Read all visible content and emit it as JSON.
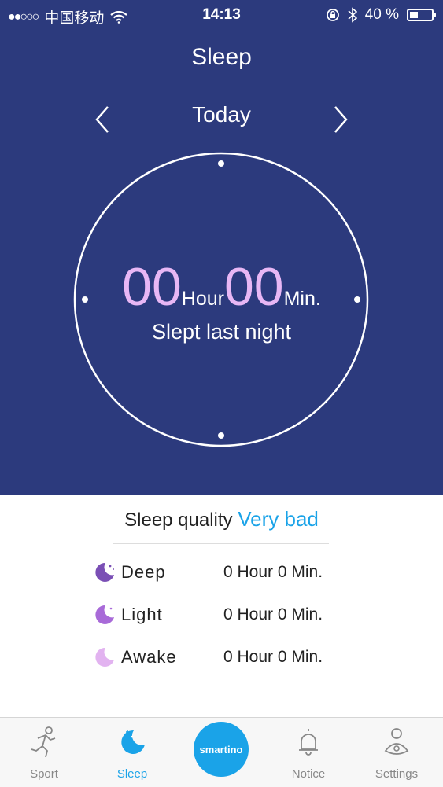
{
  "status": {
    "carrier": "中国移动",
    "time": "14:13",
    "battery": "40 %",
    "battery_level": 0.4
  },
  "header": {
    "title": "Sleep",
    "day": "Today"
  },
  "summary": {
    "hours": "00",
    "hour_unit": "Hour",
    "minutes": "00",
    "minute_unit": "Min.",
    "caption": "Slept last night"
  },
  "quality": {
    "label": "Sleep quality",
    "value": "Very bad"
  },
  "stages": [
    {
      "name": "Deep",
      "duration": "0 Hour 0 Min.",
      "color": "#7a4fb5"
    },
    {
      "name": "Light",
      "duration": "0 Hour 0 Min.",
      "color": "#a86ad8"
    },
    {
      "name": "Awake",
      "duration": "0 Hour 0 Min.",
      "color": "#e2b3f0"
    }
  ],
  "tabs": [
    {
      "label": "Sport",
      "icon": "runner-icon"
    },
    {
      "label": "Sleep",
      "icon": "moon-icon"
    },
    {
      "label": "smartino",
      "icon": "brand-logo"
    },
    {
      "label": "Notice",
      "icon": "bell-icon"
    },
    {
      "label": "Settings",
      "icon": "gear-person-icon"
    }
  ],
  "colors": {
    "header_bg": "#2c3a7d",
    "accent": "#1aa3e8",
    "number": "#e8b7f5"
  }
}
